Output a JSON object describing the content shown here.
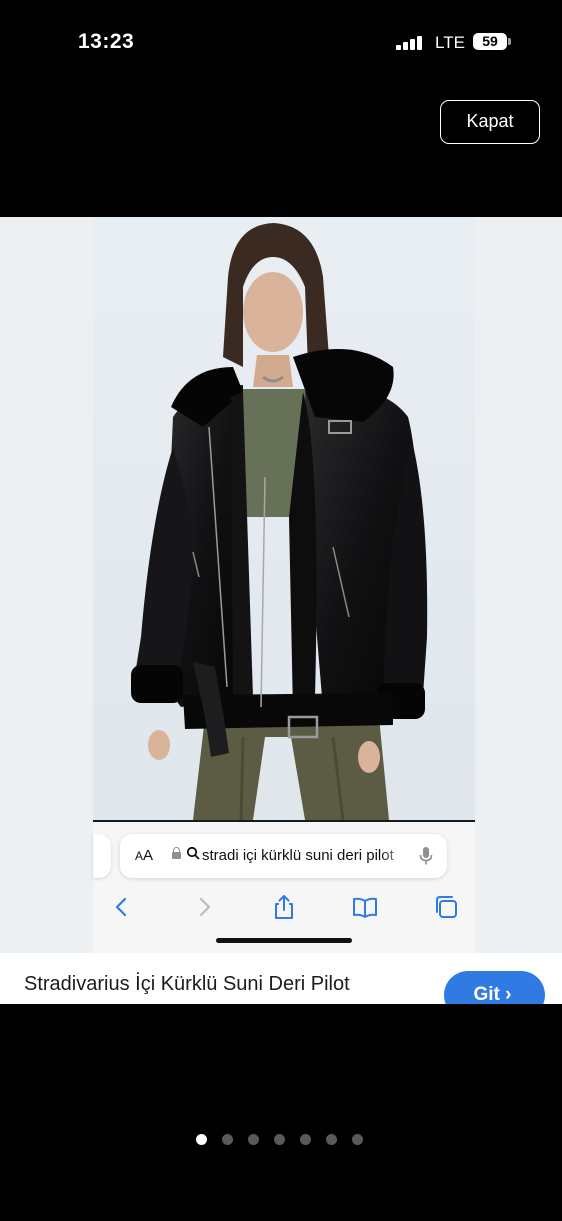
{
  "status_bar": {
    "time": "13:23",
    "network": "LTE",
    "battery": "59"
  },
  "viewer": {
    "close_label": "Kapat"
  },
  "safari": {
    "aa_label": "AA",
    "url_text": "stradi içi kürklü suni deri pilot"
  },
  "banner": {
    "title": "Stradivarius İçi Kürklü Suni Deri Pilot",
    "cta_label": "Git ›"
  },
  "pagination": {
    "count": 7,
    "active_index": 0
  }
}
